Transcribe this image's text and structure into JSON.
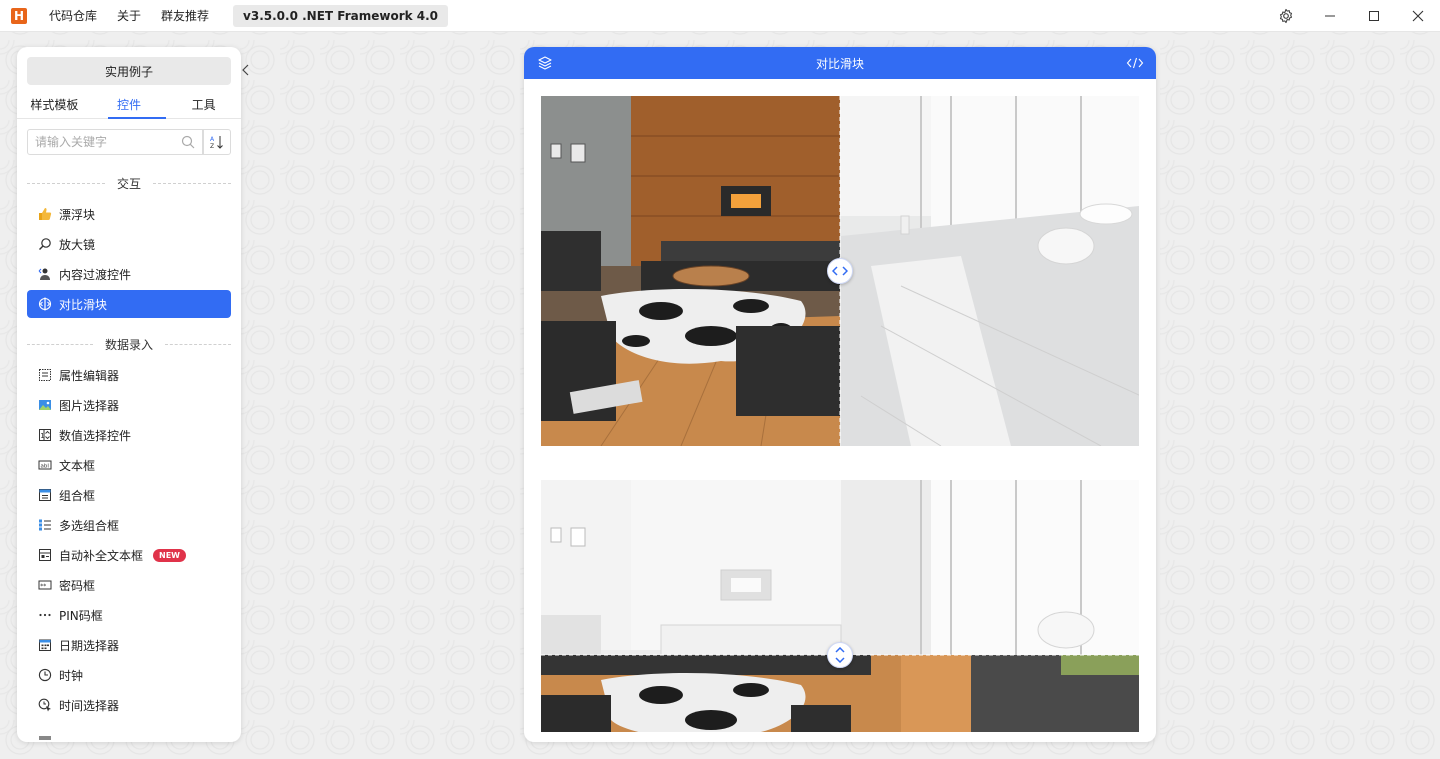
{
  "titlebar": {
    "logo_text": "H",
    "menus": [
      "代码仓库",
      "关于",
      "群友推荐"
    ],
    "version": "v3.5.0.0 .NET Framework 4.0"
  },
  "sidebar": {
    "examples_label": "实用例子",
    "tabs": [
      "样式模板",
      "控件",
      "工具"
    ],
    "active_tab": "控件",
    "search_placeholder": "请输入关键字",
    "groups": [
      {
        "title": "交互",
        "items": [
          {
            "label": "漂浮块",
            "icon": "thumbs-up-icon"
          },
          {
            "label": "放大镜",
            "icon": "magnifier-icon"
          },
          {
            "label": "内容过渡控件",
            "icon": "transition-icon"
          },
          {
            "label": "对比滑块",
            "icon": "compare-slider-icon",
            "active": true
          }
        ]
      },
      {
        "title": "数据录入",
        "items": [
          {
            "label": "属性编辑器",
            "icon": "property-editor-icon"
          },
          {
            "label": "图片选择器",
            "icon": "image-selector-icon"
          },
          {
            "label": "数值选择控件",
            "icon": "numeric-icon"
          },
          {
            "label": "文本框",
            "icon": "textbox-icon"
          },
          {
            "label": "组合框",
            "icon": "combobox-icon"
          },
          {
            "label": "多选组合框",
            "icon": "checkcombobox-icon"
          },
          {
            "label": "自动补全文本框",
            "icon": "autocomplete-icon",
            "badge": "NEW"
          },
          {
            "label": "密码框",
            "icon": "password-icon"
          },
          {
            "label": "PIN码框",
            "icon": "pin-icon"
          },
          {
            "label": "日期选择器",
            "icon": "calendar-icon"
          },
          {
            "label": "时钟",
            "icon": "clock-icon"
          },
          {
            "label": "时间选择器",
            "icon": "time-picker-icon"
          }
        ]
      }
    ]
  },
  "main": {
    "title": "对比滑块",
    "horizontal_compare_position": 0.5,
    "vertical_compare_position": 0.5
  },
  "colors": {
    "accent": "#326cf3",
    "badge": "#e0334a"
  }
}
